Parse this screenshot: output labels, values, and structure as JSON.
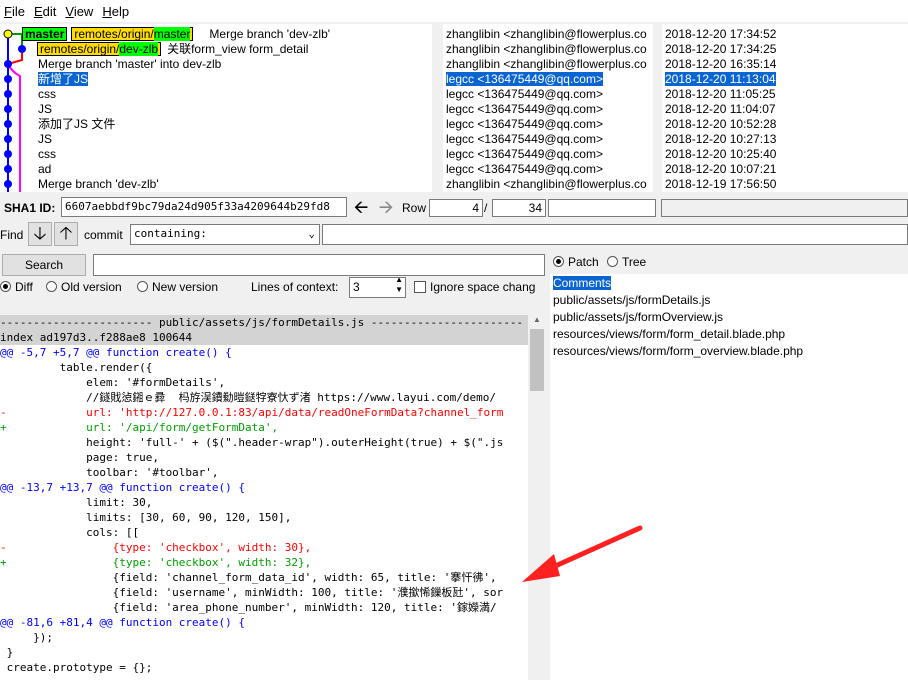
{
  "menu": [
    "File",
    "Edit",
    "View",
    "Help"
  ],
  "commits": [
    {
      "refs": [
        {
          "type": "head",
          "text": "master"
        },
        {
          "type": "remote",
          "pre": "remotes/origin/",
          "branch": "master"
        }
      ],
      "msg": "Merge branch 'dev-zlb'",
      "author": "zhanglibin <zhanglibin@flowerplus.co",
      "date": "2018-12-20 17:34:52"
    },
    {
      "refs": [
        {
          "type": "remote",
          "pre": "remotes/origin/",
          "branch": "dev-zlb"
        }
      ],
      "msg": "关联form_view form_detail",
      "author": "zhanglibin <zhanglibin@flowerplus.co",
      "date": "2018-12-20 17:34:25"
    },
    {
      "refs": [],
      "msg": "Merge branch 'master' into dev-zlb",
      "author": "zhanglibin <zhanglibin@flowerplus.co",
      "date": "2018-12-20 16:35:14"
    },
    {
      "refs": [],
      "msg": "新增了JS",
      "author": "legcc <136475449@qq.com>",
      "date": "2018-12-20 11:13:04",
      "selected": true
    },
    {
      "refs": [],
      "msg": "css",
      "author": "legcc <136475449@qq.com>",
      "date": "2018-12-20 11:05:25"
    },
    {
      "refs": [],
      "msg": "JS",
      "author": "legcc <136475449@qq.com>",
      "date": "2018-12-20 11:04:07"
    },
    {
      "refs": [],
      "msg": "添加了JS 文件",
      "author": "legcc <136475449@qq.com>",
      "date": "2018-12-20 10:52:28"
    },
    {
      "refs": [],
      "msg": "JS",
      "author": "legcc <136475449@qq.com>",
      "date": "2018-12-20 10:27:13"
    },
    {
      "refs": [],
      "msg": "css",
      "author": "legcc <136475449@qq.com>",
      "date": "2018-12-20 10:25:40"
    },
    {
      "refs": [],
      "msg": "ad",
      "author": "legcc <136475449@qq.com>",
      "date": "2018-12-20 10:07:21"
    },
    {
      "refs": [],
      "msg": "Merge branch 'dev-zlb'",
      "author": "zhanglibin <zhanglibin@flowerplus.co",
      "date": "2018-12-19 17:56:50"
    }
  ],
  "sha": {
    "label": "SHA1 ID:",
    "value": "6607aebbdf9bc79da24d905f33a4209644b29fd8",
    "row_label": "Row",
    "row": "4",
    "slash": "/",
    "total": "34"
  },
  "find": {
    "label": "Find",
    "commit_label": "commit",
    "mode": "containing:"
  },
  "search": {
    "button": "Search",
    "value": ""
  },
  "diff_opts": {
    "diff": "Diff",
    "old": "Old version",
    "new": "New version",
    "context_label": "Lines of context:",
    "context": "3",
    "ignore_space": "Ignore space chang"
  },
  "view_opts": {
    "patch": "Patch",
    "tree": "Tree"
  },
  "files": [
    "Comments",
    "public/assets/js/formDetails.js",
    "public/assets/js/formOverview.js",
    "resources/views/form/form_detail.blade.php",
    "resources/views/form/form_overview.blade.php"
  ],
  "diff": [
    {
      "t": "hdr",
      "s": "----------------------- public/assets/js/formDetails.js -----------------------"
    },
    {
      "t": "hdr",
      "s": "index ad197d3..f288ae8 100644"
    },
    {
      "t": "hunk",
      "s": "@@ -5,7 +5,7 @@ function create() {"
    },
    {
      "t": "ctx",
      "s": "         table.render({"
    },
    {
      "t": "ctx",
      "s": "             elem: '#formDetails',"
    },
    {
      "t": "ctx",
      "s": "             //鐩戝惉鎺ｅ彛  杩斿洖鐨勬暟鎹牸寮忕ず渚 https://www.layui.com/demo/"
    },
    {
      "t": "del",
      "s": "-            url: 'http://127.0.0.1:83/api/data/readOneFormData?channel_form"
    },
    {
      "t": "add",
      "s": "+            url: '/api/form/getFormData',"
    },
    {
      "t": "ctx",
      "s": "             height: 'full-' + ($(\".header-wrap\").outerHeight(true) + $(\".js"
    },
    {
      "t": "ctx",
      "s": "             page: true,"
    },
    {
      "t": "ctx",
      "s": "             toolbar: '#toolbar',"
    },
    {
      "t": "hunk",
      "s": "@@ -13,7 +13,7 @@ function create() {"
    },
    {
      "t": "ctx",
      "s": "             limit: 30,"
    },
    {
      "t": "ctx",
      "s": "             limits: [30, 60, 90, 120, 150],"
    },
    {
      "t": "ctx",
      "s": "             cols: [["
    },
    {
      "t": "del",
      "s": "-                {type: 'checkbox', width: 30},"
    },
    {
      "t": "add",
      "s": "+                {type: 'checkbox', width: 32},"
    },
    {
      "t": "ctx",
      "s": "                 {field: 'channel_form_data_id', width: 65, title: '搴忓彿',"
    },
    {
      "t": "ctx",
      "s": "                 {field: 'username', minWidth: 100, title: '濮撳悕鏁板瓧', sor"
    },
    {
      "t": "ctx",
      "s": "                 {field: 'area_phone_number', minWidth: 120, title: '鎵嬫満/"
    },
    {
      "t": "hunk",
      "s": "@@ -81,6 +81,4 @@ function create() {"
    },
    {
      "t": "ctx",
      "s": "     });"
    },
    {
      "t": "ctx",
      "s": " }"
    },
    {
      "t": "ctx",
      "s": " create.prototype = {};"
    }
  ],
  "colors": {
    "selection": "#0a64d2",
    "head_ref": "#00ff00",
    "remote_ref": "#ffdd00",
    "hunk": "#0000ff",
    "deleted": "#ff0000",
    "added": "#00a000",
    "arrow": "#ff2020"
  }
}
